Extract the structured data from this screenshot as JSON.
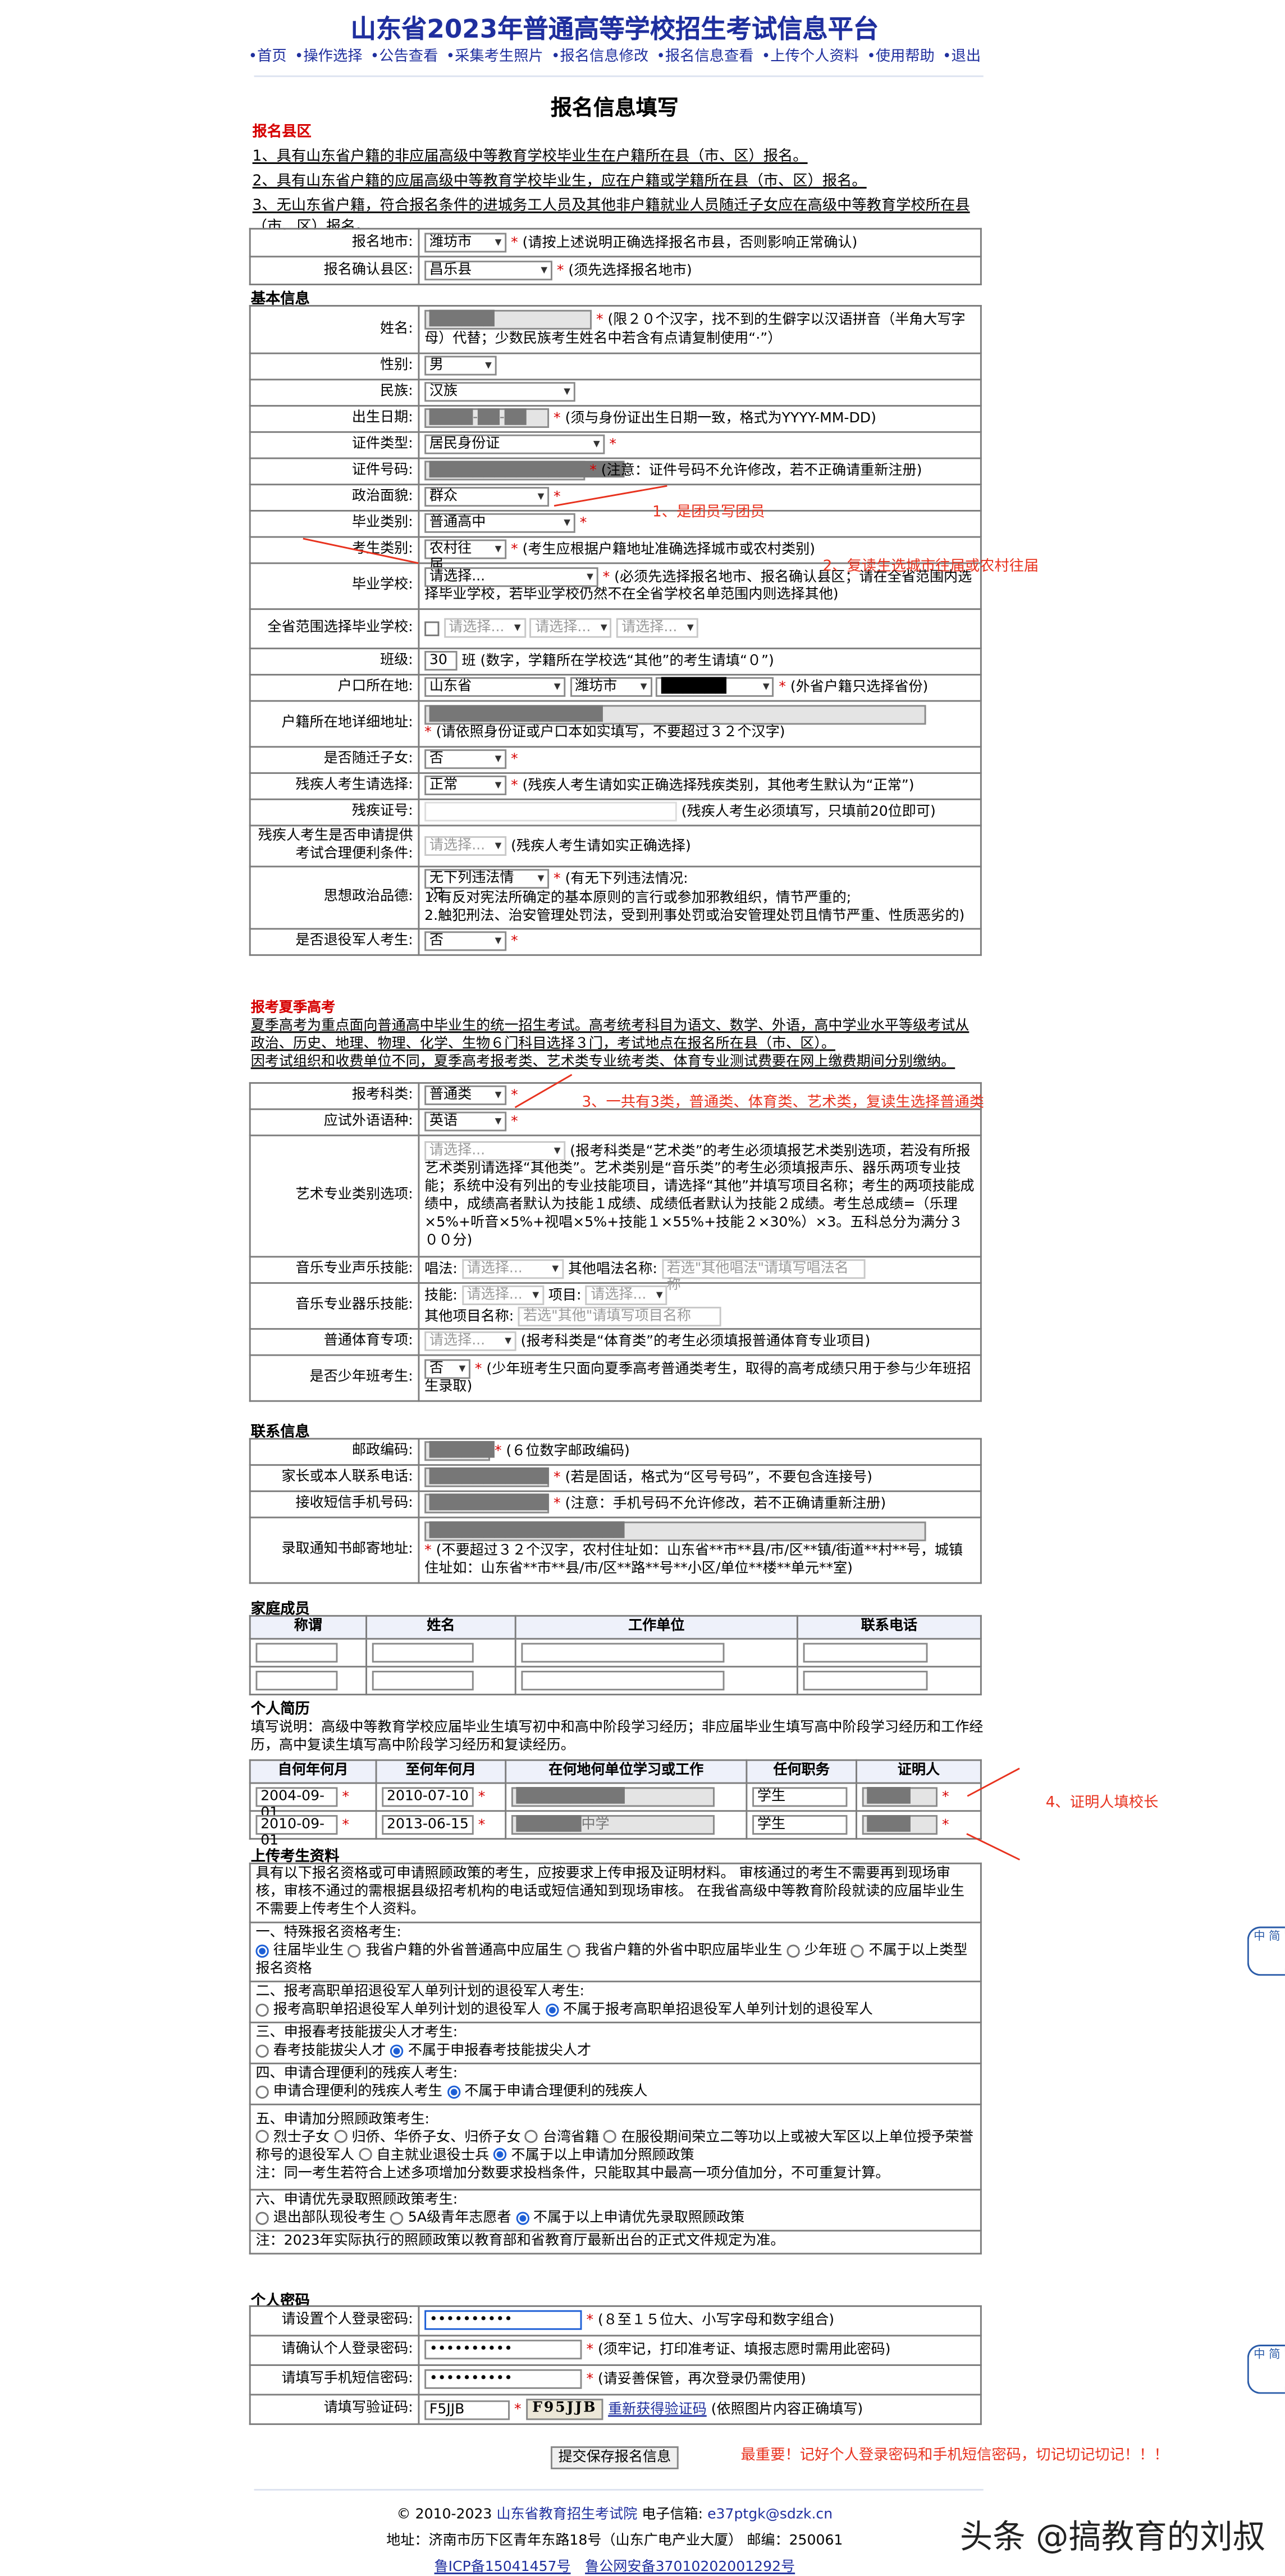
{
  "header": {
    "title": "山东省2023年普通高等学校招生考试信息平台",
    "nav": [
      "•首页",
      "•操作选择",
      "•公告查看",
      "•采集考生照片",
      "•报名信息修改",
      "•报名信息查看",
      "•上传个人资料",
      "•使用帮助",
      "•退出"
    ],
    "subtitle": "报名信息填写"
  },
  "notice": {
    "heading": "报名县区",
    "lines": [
      "1、具有山东省户籍的非应届高级中等教育学校毕业生在户籍所在县（市、区）报名。",
      "2、具有山东省户籍的应届高级中等教育学校毕业生，应在户籍或学籍所在县（市、区）报名。",
      "3、无山东省户籍，符合报名条件的进城务工人员及其他非户籍就业人员随迁子女应在高级中等教育学校所在县（市、区）报名。"
    ]
  },
  "region": {
    "city_label": "报名地市:",
    "city_value": "潍坊市",
    "city_note": "(请按上述说明正确选择报名市县，否则影响正常确认)",
    "county_label": "报名确认县区:",
    "county_value": "昌乐县",
    "county_note": "(须先选择报名地市)"
  },
  "basic": {
    "section": "基本信息",
    "name_label": "姓名:",
    "name_value": "██████",
    "name_note": "(限２０个汉字，找不到的生僻字以汉语拼音（半角大写字母）代替；少数民族考生姓名中若含有点请复制使用“·”）",
    "gender_label": "性别:",
    "gender_value": "男",
    "ethnic_label": "民族:",
    "ethnic_value": "汉族",
    "birth_label": "出生日期:",
    "birth_value": "████-██-██",
    "birth_note": "(须与身份证出生日期一致，格式为YYYY-MM-DD)",
    "idtype_label": "证件类型:",
    "idtype_value": "居民身份证",
    "idno_label": "证件号码:",
    "idno_value": "██████████████████",
    "idno_note": "(注意：证件号码不允许修改，若不正确请重新注册)",
    "political_label": "政治面貌:",
    "political_value": "群众",
    "gradtype_label": "毕业类别:",
    "gradtype_value": "普通高中",
    "examtype_label": "考生类别:",
    "examtype_value": "农村往届",
    "examtype_note": "(考生应根据户籍地址准确选择城市或农村类别)",
    "school_label": "毕业学校:",
    "school_value": "请选择...",
    "school_note": "(必须先选择报名地市、报名确认县区；请在全省范围内选择毕业学校，若毕业学校仍然不在全省学校名单范围内则选择其他)",
    "allschool_label": "全省范围选择毕业学校:",
    "allschool_opts": [
      "请选择...",
      "请选择...",
      "请选择..."
    ],
    "class_label": "班级:",
    "class_value": "30",
    "class_note": "班 (数字，学籍所在学校选“其他”的考生请填“０”)",
    "hukou_label": "户口所在地:",
    "hukou_prov": "山东省",
    "hukou_city": "潍坊市",
    "hukou_county": "██████",
    "hukou_note": "(外省户籍只选择省份)",
    "hukou_addr_label": "户籍所在地详细地址:",
    "hukou_addr_value": "████████████████",
    "hukou_addr_note": "(请依照身份证或户口本如实填写，不要超过３２个汉字)",
    "migrant_label": "是否随迁子女:",
    "migrant_value": "否",
    "disabled_label": "残疾人考生请选择:",
    "disabled_value": "正常",
    "disabled_note": "(残疾人考生请如实正确选择残疾类别，其他考生默认为“正常”)",
    "discard_label": "残疾证号:",
    "discard_note": "(残疾人考生必须填写，只填前20位即可)",
    "disneed_label": "残疾人考生是否申请提供考试合理便利条件:",
    "disneed_value": "请选择...",
    "disneed_note": "(残疾人考生请如实正确选择)",
    "moral_label": "思想政治品德:",
    "moral_value": "无下列违法情况",
    "moral_note": "(有无下列违法情况:",
    "moral_note2": "1.有反对宪法所确定的基本原则的言行或参加邪教组织，情节严重的;",
    "moral_note3": "2.触犯刑法、治安管理处罚法，受到刑事处罚或治安管理处罚且情节严重、性质恶劣的)",
    "veteran_label": "是否退役军人考生:",
    "veteran_value": "否"
  },
  "summer": {
    "heading": "报考夏季高考",
    "desc1": "夏季高考为重点面向普通高中毕业生的统一招生考试。高考统考科目为语文、数学、外语，高中学业水平等级考试从政治、历史、地理、物理、化学、生物６门科目选择３门，考试地点在报名所在县（市、区）。",
    "desc2": "因考试组织和收费单位不同，夏季高考报考类、艺术类专业统考类、体育专业测试费要在网上缴费期间分别缴纳。",
    "subject_label": "报考科类:",
    "subject_value": "普通类",
    "lang_label": "应试外语语种:",
    "lang_value": "英语",
    "art_label": "艺术专业类别选项:",
    "art_value": "请选择...",
    "art_note": "(报考科类是“艺术类”的考生必须填报艺术类别选项，若没有所报艺术类别请选择“其他类”。艺术类别是“音乐类”的考生必须填报声乐、器乐两项专业技能；系统中没有列出的专业技能项目，请选择“其他”并填写项目名称；考生的两项技能成绩中，成绩高者默认为技能１成绩、成绩低者默认为技能２成绩。考生总成绩=（乐理×5%+听音×5%+视唱×5%+技能１×55%+技能２×30%）×3。五科总分为满分３００分)",
    "music_vocal_label": "音乐专业声乐技能:",
    "music_vocal_sub": "唱法:",
    "music_vocal_value": "请选择...",
    "music_vocal_other": "其他唱法名称:",
    "music_vocal_ph": "若选\"其他唱法\"请填写唱法名称",
    "music_inst_label": "音乐专业器乐技能:",
    "music_inst_skill": "技能:",
    "music_inst_value": "请选择...",
    "music_inst_item": "项目:",
    "music_inst_item_value": "请选择...",
    "music_inst_other": "其他项目名称:",
    "music_inst_ph": "若选\"其他\"请填写项目名称",
    "sport_label": "普通体育专项:",
    "sport_value": "请选择...",
    "sport_note": "(报考科类是“体育类”的考生必须填报普通体育专业项目)",
    "youth_label": "是否少年班考生:",
    "youth_value": "否",
    "youth_note": "(少年班考生只面向夏季高考普通类考生，取得的高考成绩只用于参与少年班招生录取)"
  },
  "contact": {
    "section": "联系信息",
    "zip_label": "邮政编码:",
    "zip_value": "██████",
    "zip_note": "(６位数字邮政编码)",
    "phone_label": "家长或本人联系电话:",
    "phone_value": "███████████",
    "phone_note": "(若是固话，格式为“区号号码”，不要包含连接号)",
    "sms_label": "接收短信手机号码:",
    "sms_value": "███████████",
    "sms_note": "(注意：手机号码不允许修改，若不正确请重新注册)",
    "mail_label": "录取通知书邮寄地址:",
    "mail_value": "██████████████████",
    "mail_note": "(不要超过３２个汉字，农村住址如：山东省**市**县/市/区**镇/街道**村**号，城镇住址如：山东省**市**县/市/区**路**号**小区/单位**楼**单元**室)"
  },
  "family": {
    "section": "家庭成员",
    "headers": [
      "称谓",
      "姓名",
      "工作单位",
      "联系电话"
    ]
  },
  "resume": {
    "section": "个人简历",
    "note": "填写说明：高级中等教育学校应届毕业生填写初中和高中阶段学习经历；非应届毕业生填写高中阶段学习经历和工作经历，高中复读生填写高中阶段学习经历和复读经历。",
    "headers": [
      "自何年何月",
      "至何年何月",
      "在何地何单位学习或工作",
      "任何职务",
      "证明人"
    ],
    "rows": [
      {
        "from": "2004-09-01",
        "to": "2010-07-10",
        "unit": "██████████",
        "post": "学生",
        "witness": "████"
      },
      {
        "from": "2010-09-01",
        "to": "2013-06-15",
        "unit": "██████中学",
        "post": "学生",
        "witness": "████"
      }
    ]
  },
  "upload": {
    "section": "上传考生资料",
    "intro": "具有以下报名资格或可申请照顾政策的考生，应按要求上传申报及证明材料。 审核通过的考生不需要再到现场审核，审核不通过的需根据县级招考机构的电话或短信通知到现场审核。 在我省高级中等教育阶段就读的应届毕业生不需要上传考生个人资料。",
    "g1_title": "一、特殊报名资格考生:",
    "g1_opts": [
      "往届毕业生",
      "我省户籍的外省普通高中应届生",
      "我省户籍的外省中职应届毕业生",
      "少年班",
      "不属于以上类型报名资格"
    ],
    "g2_title": "二、报考高职单招退役军人单列计划的退役军人考生:",
    "g2_opts": [
      "报考高职单招退役军人单列计划的退役军人",
      "不属于报考高职单招退役军人单列计划的退役军人"
    ],
    "g3_title": "三、申报春考技能拔尖人才考生:",
    "g3_opts": [
      "春考技能拔尖人才",
      "不属于申报春考技能拔尖人才"
    ],
    "g4_title": "四、申请合理便利的残疾人考生:",
    "g4_opts": [
      "申请合理便利的残疾人考生",
      "不属于申请合理便利的残疾人"
    ],
    "g5_title": "五、申请加分照顾政策考生:",
    "g5_opts": [
      "烈士子女",
      "归侨、华侨子女、归侨子女",
      "台湾省籍",
      "在服役期间荣立二等功以上或被大军区以上单位授予荣誉称号的退役军人",
      "自主就业退役士兵",
      "不属于以上申请加分照顾政策"
    ],
    "g5_note": "注：同一考生若符合上述多项增加分数要求投档条件，只能取其中最高一项分值加分，不可重复计算。",
    "g6_title": "六、申请优先录取照顾政策考生:",
    "g6_opts": [
      "退出部队现役考生",
      "5A级青年志愿者",
      "不属于以上申请优先录取照顾政策"
    ],
    "g6_note": "注：2023年实际执行的照顾政策以教育部和省教育厅最新出台的正式文件规定为准。"
  },
  "password": {
    "section": "个人密码",
    "pwd_label": "请设置个人登录密码:",
    "pwd_value": "••••••••••",
    "pwd_note": "(８至１５位大、小写字母和数字组合)",
    "confirm_label": "请确认个人登录密码:",
    "confirm_value": "••••••••••",
    "confirm_note": "(须牢记，打印准考证、填报志愿时需用此密码)",
    "sms_label": "请填写手机短信密码:",
    "sms_value": "••••••••••",
    "sms_note": "(请妥善保管，再次登录仍需使用)",
    "captcha_label": "请填写验证码:",
    "captcha_value": "F5JJB",
    "captcha_img": "F95JJB",
    "captcha_refresh": "重新获得验证码",
    "captcha_note": "(依照图片内容正确填写)",
    "submit": "提交保存报名信息"
  },
  "annotations": {
    "a1": "1、是团员写团员",
    "a2": "2、复读生选城市往届或农村往届",
    "a3": "3、一共有3类，普通类、体育类、艺术类，复读生选择普通类",
    "a4": "4、证明人填校长",
    "a5": "最重要！记好个人登录密码和手机短信密码，切记切记切记！！！"
  },
  "footer": {
    "line1a": "© 2010-2023 ",
    "line1b": "山东省教育招生考试院",
    "line1c": " 电子信箱: ",
    "line1d": "e37ptgk@sdzk.cn",
    "line2": "地址：济南市历下区青年东路18号（山东广电产业大厦） 邮编：250061",
    "line3a": "鲁ICP备15041457号",
    "line3b": "鲁公网安备37010202001292号"
  },
  "side": {
    "tab1": "中 简",
    "tab2": "中 简"
  },
  "watermark": "头条 @搞教育的刘叔"
}
